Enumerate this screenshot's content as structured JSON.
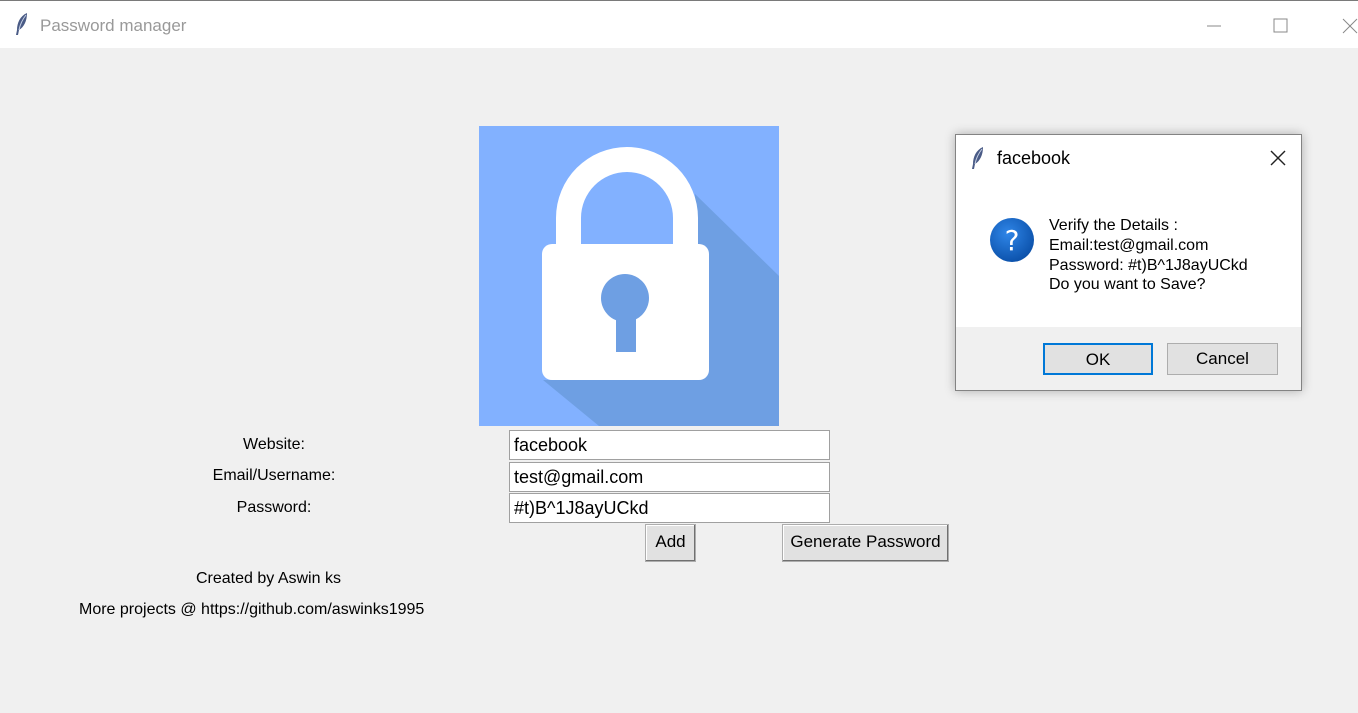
{
  "window": {
    "title": "Password manager",
    "icons": {
      "app": "feather-icon",
      "minimize": "minimize-icon",
      "maximize": "maximize-icon",
      "close": "close-icon"
    }
  },
  "image": {
    "name": "padlock-icon",
    "colors": {
      "background": "#82b1ff",
      "shadow": "#6e9fe3",
      "lock": "#ffffff"
    }
  },
  "form": {
    "website_label": "Website:",
    "email_label": "Email/Username:",
    "password_label": "Password:",
    "website_value": "facebook",
    "email_value": "test@gmail.com",
    "password_value": "#t)B^1J8ayUCkd",
    "add_label": "Add",
    "generate_label": "Generate Password"
  },
  "footer": {
    "credit": "Created by Aswin ks",
    "more_projects": "More projects @ https://github.com/aswinks1995"
  },
  "dialog": {
    "title": "facebook",
    "icon": "question-icon",
    "lines": [
      "Verify the Details :",
      "Email:test@gmail.com",
      "Password: #t)B^1J8ayUCkd",
      "Do you want to Save?"
    ],
    "ok_label": "OK",
    "cancel_label": "Cancel",
    "colors": {
      "question": "#0b63c2",
      "focus": "#0078d7"
    }
  }
}
